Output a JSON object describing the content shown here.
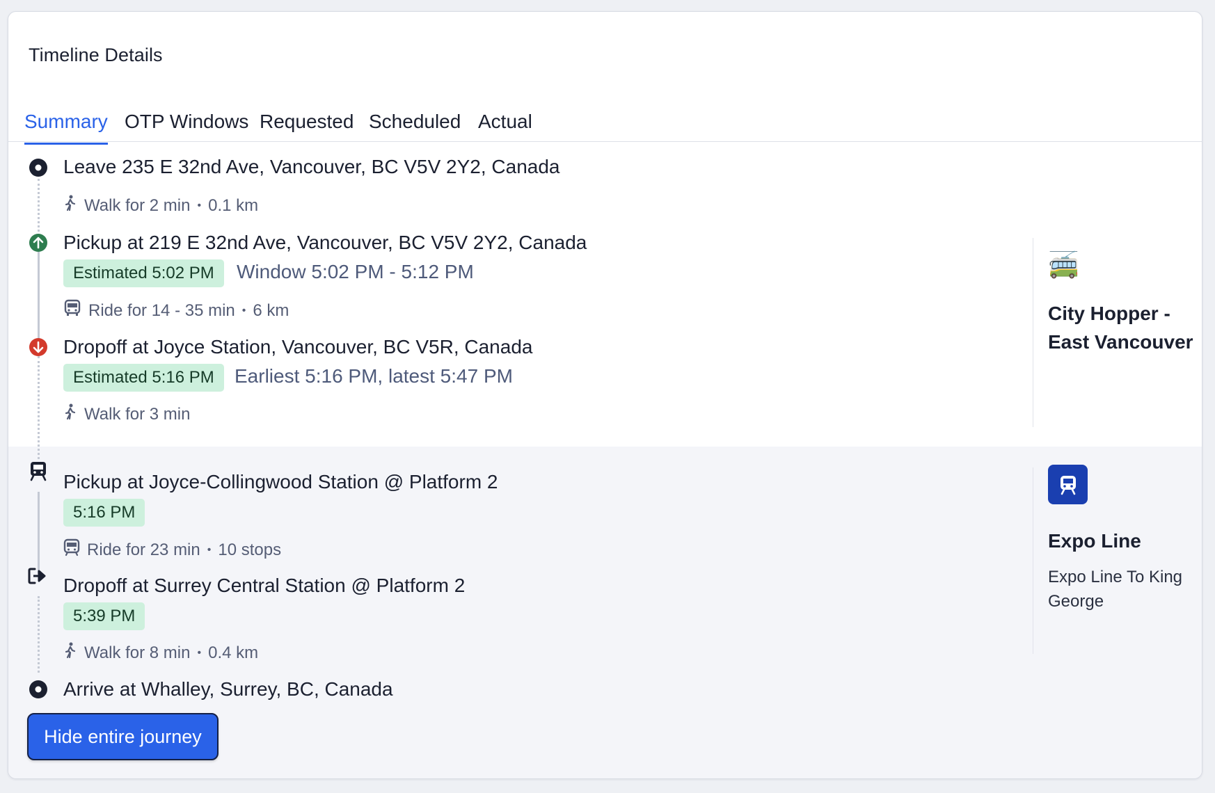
{
  "title": "Timeline Details",
  "tabs": [
    {
      "label": "Summary",
      "active": true
    },
    {
      "label": "OTP Windows",
      "active": false
    },
    {
      "label": "Requested",
      "active": false
    },
    {
      "label": "Scheduled",
      "active": false
    },
    {
      "label": "Actual",
      "active": false
    }
  ],
  "timeline": {
    "leave": {
      "text": "Leave 235 E 32nd Ave, Vancouver, BC V5V 2Y2, Canada",
      "icon": "origin-dot-icon"
    },
    "walk1": {
      "text": "Walk for 2 min",
      "distance": "0.1 km",
      "icon": "walk-icon"
    },
    "pickup1": {
      "text": "Pickup at 219 E 32nd Ave, Vancouver, BC V5V 2Y2, Canada",
      "badge": "Estimated 5:02 PM",
      "window": "Window 5:02 PM - 5:12 PM",
      "icon": "arrow-up-circle-icon"
    },
    "ride1": {
      "text": "Ride for 14 - 35 min",
      "distance": "6 km",
      "icon": "bus-icon"
    },
    "dropoff1": {
      "text": "Dropoff at Joyce Station, Vancouver, BC V5R, Canada",
      "badge": "Estimated 5:16 PM",
      "window": "Earliest 5:16 PM, latest 5:47 PM",
      "icon": "arrow-down-circle-icon"
    },
    "walk2": {
      "text": "Walk for 3 min",
      "icon": "walk-icon"
    },
    "pickup2": {
      "text": "Pickup at Joyce-Collingwood Station @ Platform 2",
      "badge": "5:16 PM",
      "icon": "train-icon"
    },
    "ride2": {
      "text": "Ride for 23 min",
      "stops": "10 stops",
      "icon": "train-icon"
    },
    "dropoff2": {
      "text": "Dropoff at Surrey Central Station @ Platform 2",
      "badge": "5:39 PM",
      "icon": "exit-arrow-icon"
    },
    "walk3": {
      "text": "Walk for 8 min",
      "distance": "0.4 km",
      "icon": "walk-icon"
    },
    "arrive": {
      "text": "Arrive at Whalley, Surrey, BC, Canada",
      "icon": "destination-dot-icon"
    }
  },
  "side": {
    "shuttle": {
      "icon": "trolleybus-icon",
      "emoji": "🚎",
      "name": "City Hopper - East Vancouver"
    },
    "expo": {
      "icon": "train-icon",
      "name": "Expo Line",
      "sub": "Expo Line To King George",
      "color": "#1a3fb0"
    }
  },
  "button": {
    "label": "Hide entire journey"
  },
  "colors": {
    "accent": "#2a62e8",
    "pickup_green": "#2e7d4f",
    "dropoff_red": "#d33a2c",
    "badge_bg": "#cdf0dd",
    "section_gray": "#f4f5f9"
  }
}
